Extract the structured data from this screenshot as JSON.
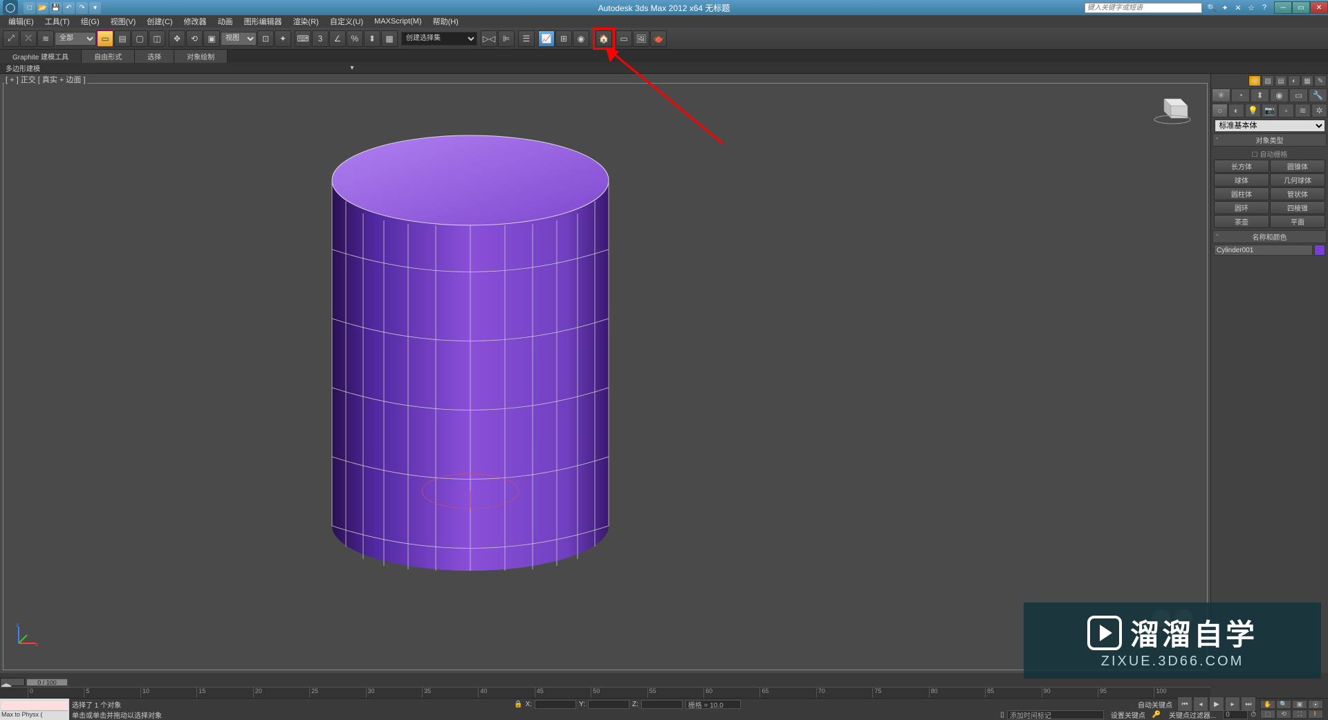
{
  "app": {
    "title": "Autodesk 3ds Max  2012 x64     无标题",
    "search_placeholder": "键入关键字或短语"
  },
  "menubar": [
    "编辑(E)",
    "工具(T)",
    "组(G)",
    "视图(V)",
    "创建(C)",
    "修改器",
    "动画",
    "图形编辑器",
    "渲染(R)",
    "自定义(U)",
    "MAXScript(M)",
    "帮助(H)"
  ],
  "toolbar": {
    "filter_label": "全部",
    "refsys_label": "视图",
    "namedset_label": "创建选择集"
  },
  "ribbon": {
    "tab1": "Graphite 建模工具",
    "tab2": "自由形式",
    "tab3": "选择",
    "tab4": "对象绘制",
    "sub": "多边形建模"
  },
  "viewport": {
    "label": "[ + ] 正交 [ 真实 + 边面 ]"
  },
  "panel": {
    "category": "标准基本体",
    "rollout_type": "对象类型",
    "autogrid": "自动栅格",
    "primitives": [
      "长方体",
      "圆锥体",
      "球体",
      "几何球体",
      "圆柱体",
      "管状体",
      "圆环",
      "四棱锥",
      "茶壶",
      "平面"
    ],
    "rollout_name": "名称和颜色",
    "object_name": "Cylinder001"
  },
  "time": {
    "slider": "0 / 100",
    "ticks": [
      "0",
      "5",
      "10",
      "15",
      "20",
      "25",
      "30",
      "35",
      "40",
      "45",
      "50",
      "55",
      "60",
      "65",
      "70",
      "75",
      "80",
      "85",
      "90",
      "95",
      "100"
    ]
  },
  "status": {
    "script": "Max to Physx (",
    "line1": "选择了 1 个对象",
    "line2": "单击或单击并拖动以选择对象",
    "x": "X:",
    "y": "Y:",
    "z": "Z:",
    "grid": "栅格 = 10.0",
    "addtime": "添加时间标记",
    "autokey": "自动关键点",
    "setkey": "设置关键点",
    "keyfilter": "关键点过滤器..."
  },
  "watermark": {
    "main": "溜溜自学",
    "sub": "ZIXUE.3D66.COM"
  }
}
